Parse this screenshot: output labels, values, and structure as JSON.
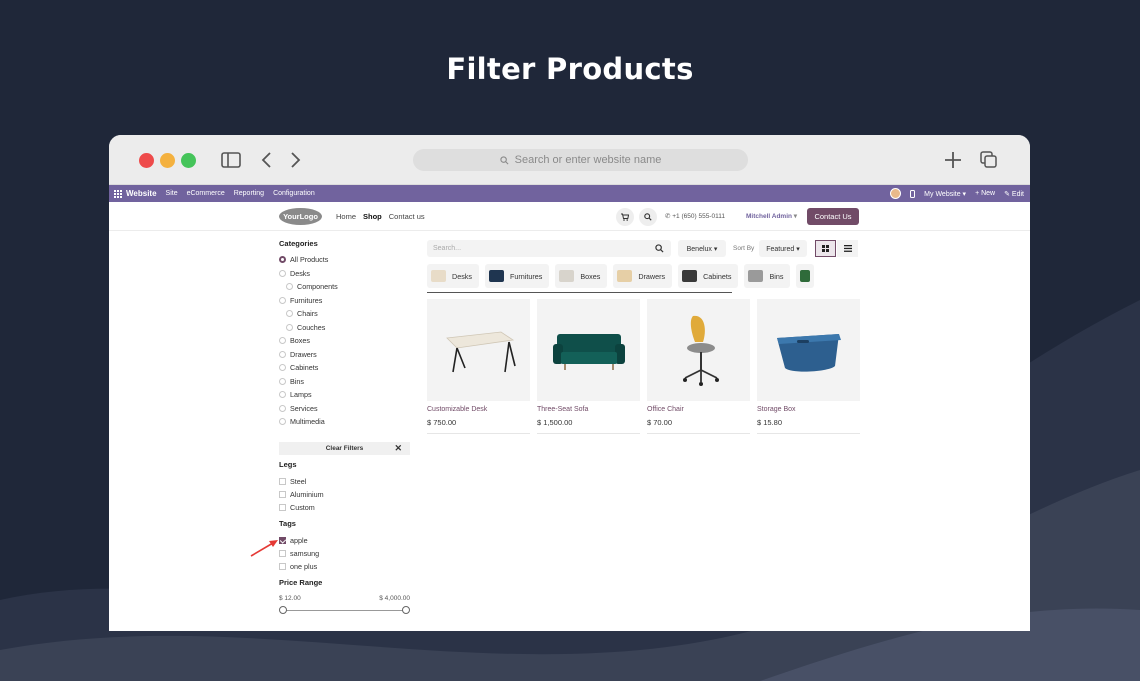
{
  "headline": "Filter Products",
  "browser": {
    "address_placeholder": "Search or enter website name"
  },
  "odoo_bar": {
    "app_name": "Website",
    "menus": [
      "Site",
      "eCommerce",
      "Reporting",
      "Configuration"
    ],
    "my_website": "My Website ▾",
    "new": "+ New",
    "edit": "✎ Edit"
  },
  "site_header": {
    "logo": "YourLogo",
    "nav": [
      "Home",
      "Shop",
      "Contact us"
    ],
    "phone": "+1 (650) 555-0111",
    "user": "Mitchell Admin",
    "contact_button": "Contact Us"
  },
  "sidebar": {
    "categories_title": "Categories",
    "categories": [
      {
        "label": "All Products",
        "selected": true
      },
      {
        "label": "Desks"
      },
      {
        "label": "Components"
      },
      {
        "label": "Furnitures"
      },
      {
        "label": "Chairs"
      },
      {
        "label": "Couches"
      },
      {
        "label": "Boxes"
      },
      {
        "label": "Drawers"
      },
      {
        "label": "Cabinets"
      },
      {
        "label": "Bins"
      },
      {
        "label": "Lamps"
      },
      {
        "label": "Services"
      },
      {
        "label": "Multimedia"
      }
    ],
    "clear_filters": "Clear Filters",
    "legs_title": "Legs",
    "legs": [
      "Steel",
      "Aluminium",
      "Custom"
    ],
    "tags_title": "Tags",
    "tags": [
      {
        "label": "apple",
        "checked": true
      },
      {
        "label": "samsung",
        "checked": false
      },
      {
        "label": "one plus",
        "checked": false
      }
    ],
    "price_title": "Price Range",
    "price_min": "$ 12.00",
    "price_max": "$ 4,000.00"
  },
  "toolbar": {
    "search_placeholder": "Search...",
    "pricelist": "Benelux ▾",
    "sort_label": "Sort By",
    "sort_value": "Featured ▾"
  },
  "category_chips": [
    "Desks",
    "Furnitures",
    "Boxes",
    "Drawers",
    "Cabinets",
    "Bins"
  ],
  "products": [
    {
      "name": "Customizable Desk",
      "price": "$ 750.00"
    },
    {
      "name": "Three-Seat Sofa",
      "price": "$ 1,500.00"
    },
    {
      "name": "Office Chair",
      "price": "$ 70.00"
    },
    {
      "name": "Storage Box",
      "price": "$ 15.80"
    }
  ],
  "colors": {
    "accent": "#714b67",
    "odoo_bar": "#71639e",
    "page_bg": "#1f2739"
  }
}
